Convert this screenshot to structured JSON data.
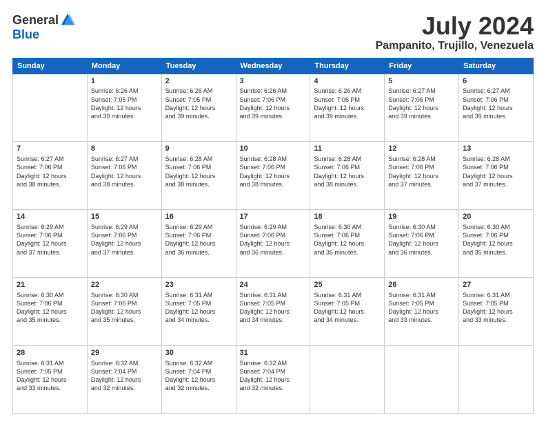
{
  "logo": {
    "general": "General",
    "blue": "Blue"
  },
  "title": {
    "month": "July 2024",
    "location": "Pampanito, Trujillo, Venezuela"
  },
  "days_of_week": [
    "Sunday",
    "Monday",
    "Tuesday",
    "Wednesday",
    "Thursday",
    "Friday",
    "Saturday"
  ],
  "weeks": [
    [
      {
        "day": "",
        "detail": ""
      },
      {
        "day": "1",
        "detail": "Sunrise: 6:26 AM\nSunset: 7:05 PM\nDaylight: 12 hours\nand 39 minutes."
      },
      {
        "day": "2",
        "detail": "Sunrise: 6:26 AM\nSunset: 7:05 PM\nDaylight: 12 hours\nand 39 minutes."
      },
      {
        "day": "3",
        "detail": "Sunrise: 6:26 AM\nSunset: 7:06 PM\nDaylight: 12 hours\nand 39 minutes."
      },
      {
        "day": "4",
        "detail": "Sunrise: 6:26 AM\nSunset: 7:06 PM\nDaylight: 12 hours\nand 39 minutes."
      },
      {
        "day": "5",
        "detail": "Sunrise: 6:27 AM\nSunset: 7:06 PM\nDaylight: 12 hours\nand 39 minutes."
      },
      {
        "day": "6",
        "detail": "Sunrise: 6:27 AM\nSunset: 7:06 PM\nDaylight: 12 hours\nand 39 minutes."
      }
    ],
    [
      {
        "day": "7",
        "detail": "Sunrise: 6:27 AM\nSunset: 7:06 PM\nDaylight: 12 hours\nand 38 minutes."
      },
      {
        "day": "8",
        "detail": "Sunrise: 6:27 AM\nSunset: 7:06 PM\nDaylight: 12 hours\nand 38 minutes."
      },
      {
        "day": "9",
        "detail": "Sunrise: 6:28 AM\nSunset: 7:06 PM\nDaylight: 12 hours\nand 38 minutes."
      },
      {
        "day": "10",
        "detail": "Sunrise: 6:28 AM\nSunset: 7:06 PM\nDaylight: 12 hours\nand 38 minutes."
      },
      {
        "day": "11",
        "detail": "Sunrise: 6:28 AM\nSunset: 7:06 PM\nDaylight: 12 hours\nand 38 minutes."
      },
      {
        "day": "12",
        "detail": "Sunrise: 6:28 AM\nSunset: 7:06 PM\nDaylight: 12 hours\nand 37 minutes."
      },
      {
        "day": "13",
        "detail": "Sunrise: 6:28 AM\nSunset: 7:06 PM\nDaylight: 12 hours\nand 37 minutes."
      }
    ],
    [
      {
        "day": "14",
        "detail": "Sunrise: 6:29 AM\nSunset: 7:06 PM\nDaylight: 12 hours\nand 37 minutes."
      },
      {
        "day": "15",
        "detail": "Sunrise: 6:29 AM\nSunset: 7:06 PM\nDaylight: 12 hours\nand 37 minutes."
      },
      {
        "day": "16",
        "detail": "Sunrise: 6:29 AM\nSunset: 7:06 PM\nDaylight: 12 hours\nand 36 minutes."
      },
      {
        "day": "17",
        "detail": "Sunrise: 6:29 AM\nSunset: 7:06 PM\nDaylight: 12 hours\nand 36 minutes."
      },
      {
        "day": "18",
        "detail": "Sunrise: 6:30 AM\nSunset: 7:06 PM\nDaylight: 12 hours\nand 36 minutes."
      },
      {
        "day": "19",
        "detail": "Sunrise: 6:30 AM\nSunset: 7:06 PM\nDaylight: 12 hours\nand 36 minutes."
      },
      {
        "day": "20",
        "detail": "Sunrise: 6:30 AM\nSunset: 7:06 PM\nDaylight: 12 hours\nand 35 minutes."
      }
    ],
    [
      {
        "day": "21",
        "detail": "Sunrise: 6:30 AM\nSunset: 7:06 PM\nDaylight: 12 hours\nand 35 minutes."
      },
      {
        "day": "22",
        "detail": "Sunrise: 6:30 AM\nSunset: 7:06 PM\nDaylight: 12 hours\nand 35 minutes."
      },
      {
        "day": "23",
        "detail": "Sunrise: 6:31 AM\nSunset: 7:05 PM\nDaylight: 12 hours\nand 34 minutes."
      },
      {
        "day": "24",
        "detail": "Sunrise: 6:31 AM\nSunset: 7:05 PM\nDaylight: 12 hours\nand 34 minutes."
      },
      {
        "day": "25",
        "detail": "Sunrise: 6:31 AM\nSunset: 7:05 PM\nDaylight: 12 hours\nand 34 minutes."
      },
      {
        "day": "26",
        "detail": "Sunrise: 6:31 AM\nSunset: 7:05 PM\nDaylight: 12 hours\nand 33 minutes."
      },
      {
        "day": "27",
        "detail": "Sunrise: 6:31 AM\nSunset: 7:05 PM\nDaylight: 12 hours\nand 33 minutes."
      }
    ],
    [
      {
        "day": "28",
        "detail": "Sunrise: 6:31 AM\nSunset: 7:05 PM\nDaylight: 12 hours\nand 33 minutes."
      },
      {
        "day": "29",
        "detail": "Sunrise: 6:32 AM\nSunset: 7:04 PM\nDaylight: 12 hours\nand 32 minutes."
      },
      {
        "day": "30",
        "detail": "Sunrise: 6:32 AM\nSunset: 7:04 PM\nDaylight: 12 hours\nand 32 minutes."
      },
      {
        "day": "31",
        "detail": "Sunrise: 6:32 AM\nSunset: 7:04 PM\nDaylight: 12 hours\nand 32 minutes."
      },
      {
        "day": "",
        "detail": ""
      },
      {
        "day": "",
        "detail": ""
      },
      {
        "day": "",
        "detail": ""
      }
    ]
  ]
}
